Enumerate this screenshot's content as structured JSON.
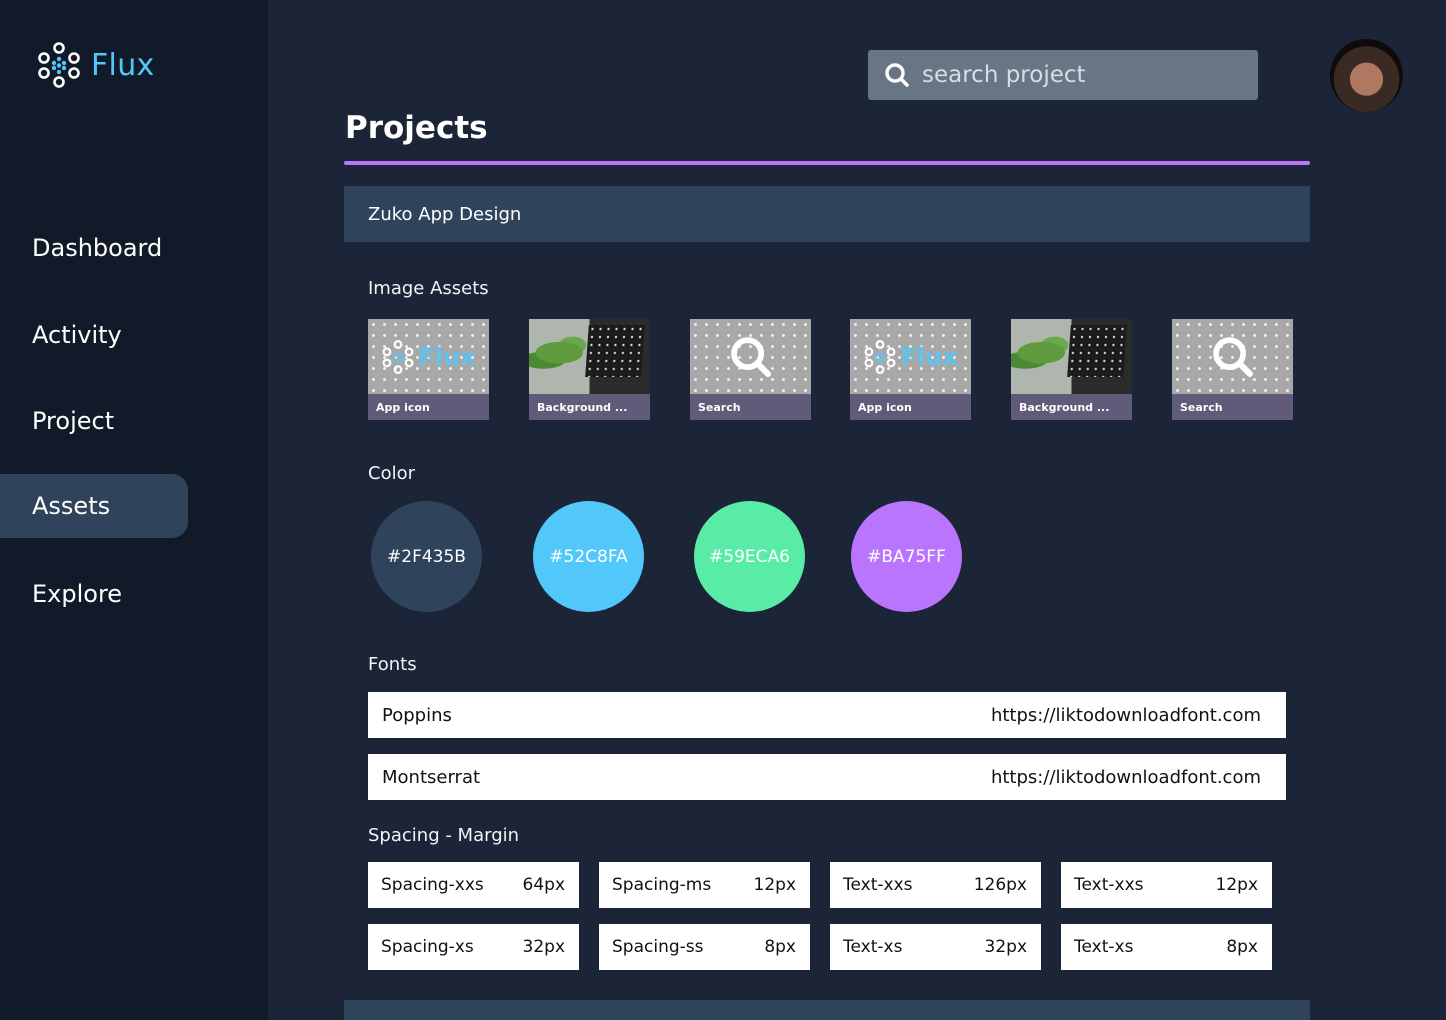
{
  "app": {
    "name": "Flux"
  },
  "sidebar": {
    "items": [
      {
        "label": "Dashboard"
      },
      {
        "label": "Activity"
      },
      {
        "label": "Project"
      },
      {
        "label": "Assets",
        "active": true
      },
      {
        "label": "Explore"
      }
    ]
  },
  "search": {
    "placeholder": "search project",
    "icon": "search-icon"
  },
  "page": {
    "title": "Projects",
    "accent": "#BA75FF"
  },
  "project": {
    "name": "Zuko App Design"
  },
  "sections": {
    "image_assets": "Image Assets",
    "color": "Color",
    "fonts": "Fonts",
    "spacing": "Spacing - Margin"
  },
  "image_assets": [
    {
      "label": "App icon",
      "kind": "logo"
    },
    {
      "label": "Background ...",
      "kind": "photo"
    },
    {
      "label": "Search",
      "kind": "search"
    },
    {
      "label": "App icon",
      "kind": "logo"
    },
    {
      "label": "Background ...",
      "kind": "photo"
    },
    {
      "label": "Search",
      "kind": "search"
    }
  ],
  "colors": [
    {
      "label": "#2F435B",
      "hex": "#2F435B"
    },
    {
      "label": "#52C8FA",
      "hex": "#52C8FA"
    },
    {
      "label": "#59ECA6",
      "hex": "#59ECA6"
    },
    {
      "label": "#BA75FF",
      "hex": "#BA75FF"
    }
  ],
  "fonts": [
    {
      "name": "Poppins",
      "url": "https://liktodownloadfont.com"
    },
    {
      "name": "Montserrat",
      "url": "https://liktodownloadfont.com"
    }
  ],
  "spacing": [
    {
      "name": "Spacing-xxs",
      "value": "64px"
    },
    {
      "name": "Spacing-ms",
      "value": "12px"
    },
    {
      "name": "Text-xxs",
      "value": "126px"
    },
    {
      "name": "Text-xxs",
      "value": "12px"
    },
    {
      "name": "Spacing-xs",
      "value": "32px"
    },
    {
      "name": "Spacing-ss",
      "value": "8px"
    },
    {
      "name": "Text-xs",
      "value": "32px"
    },
    {
      "name": "Text-xs",
      "value": "8px"
    }
  ]
}
